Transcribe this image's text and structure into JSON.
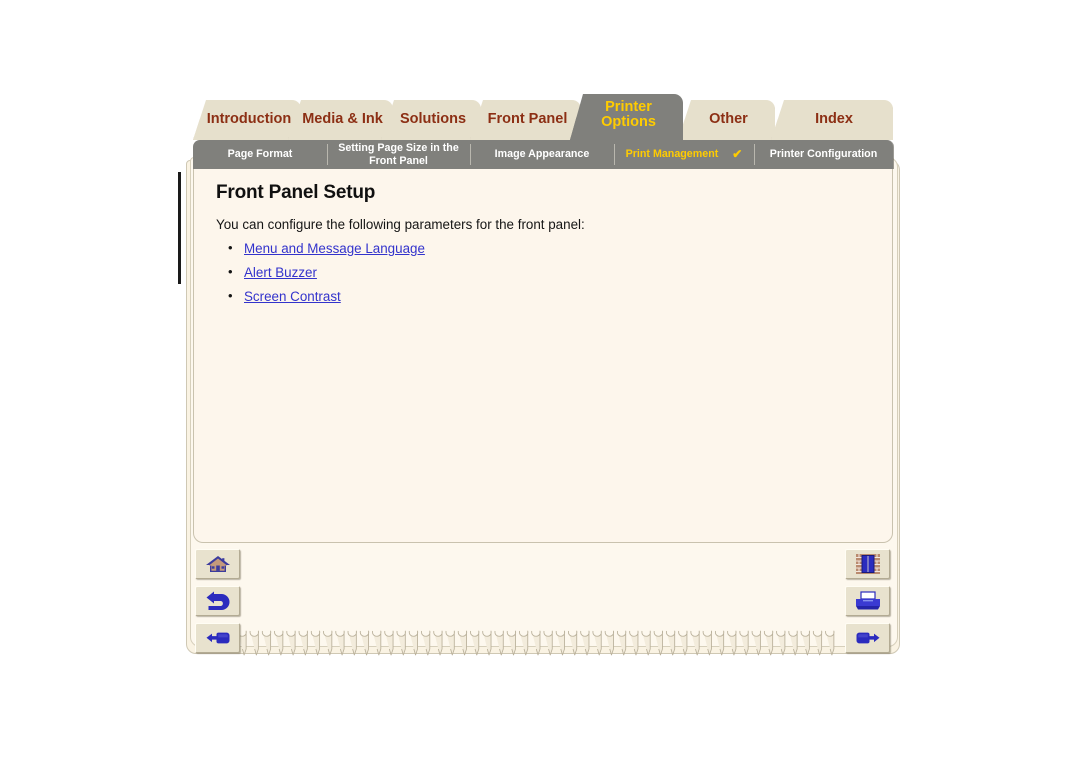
{
  "colors": {
    "tab_bg": "#e6e0cc",
    "tab_text": "#8c2f14",
    "active_tab_bg": "#80807c",
    "active_tab_text": "#ffcc00",
    "page_bg": "#fdf6ec",
    "link": "#3333cc",
    "button_bg": "#e8e2ce",
    "icon_blue": "#3333aa"
  },
  "tabs": [
    {
      "label": "Introduction",
      "active": false,
      "name": "tab-introduction"
    },
    {
      "label": "Media & Ink",
      "active": false,
      "name": "tab-media-and-ink"
    },
    {
      "label": "Solutions",
      "active": false,
      "name": "tab-solutions"
    },
    {
      "label": "Front Panel",
      "active": false,
      "name": "tab-front-panel"
    },
    {
      "label": "Printer",
      "label2": "Options",
      "active": true,
      "name": "tab-printer-options"
    },
    {
      "label": "Other",
      "active": false,
      "name": "tab-other"
    },
    {
      "label": "Index",
      "active": false,
      "name": "tab-index"
    }
  ],
  "subtabs": [
    {
      "label": "Page Format",
      "selected": false
    },
    {
      "label": "Setting Page Size in the",
      "label2": "Front Panel",
      "selected": false
    },
    {
      "label": "Image Appearance",
      "selected": false
    },
    {
      "label": "Print Management",
      "selected": true,
      "check": "✔"
    },
    {
      "label": "Printer Configuration",
      "selected": false
    }
  ],
  "content": {
    "title": "Front Panel Setup",
    "intro": "You can configure the following parameters for the front panel:",
    "links": [
      "Menu and Message Language",
      "Alert Buzzer",
      "Screen Contrast"
    ]
  },
  "nav_buttons": {
    "left": [
      {
        "icon": "home-icon",
        "title": "Home"
      },
      {
        "icon": "back-arrow-icon",
        "title": "Back"
      },
      {
        "icon": "hand-pointing-left-icon",
        "title": "Previous Page"
      }
    ],
    "right": [
      {
        "icon": "bookcase-exit-icon",
        "title": "Contents"
      },
      {
        "icon": "printer-icon",
        "title": "Print"
      },
      {
        "icon": "hand-pointing-right-icon",
        "title": "Next Page"
      }
    ]
  },
  "decor": {
    "spiral_coils": 49
  }
}
